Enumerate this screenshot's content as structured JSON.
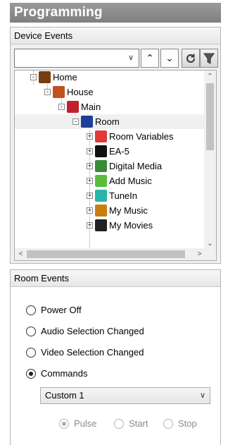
{
  "window": {
    "title": "Programming"
  },
  "device_events": {
    "header": "Device Events",
    "combo_value": "",
    "tree": [
      {
        "label": "Home",
        "icon": "home-icon",
        "expander": "-",
        "color": "#7a3d0c"
      },
      {
        "label": "House",
        "icon": "house-icon",
        "expander": "-",
        "color": "#c0521e"
      },
      {
        "label": "Main",
        "icon": "floor-icon",
        "expander": "-",
        "color": "#c2202e"
      },
      {
        "label": "Room",
        "icon": "room-icon",
        "expander": "-",
        "color": "#1d3f9a",
        "selected": true
      },
      {
        "label": "Room Variables",
        "icon": "variables-icon",
        "expander": "+",
        "color": "#e03a3a"
      },
      {
        "label": "EA-5",
        "icon": "controller-icon",
        "expander": "+",
        "color": "#111111"
      },
      {
        "label": "Digital Media",
        "icon": "digital-media-icon",
        "expander": "+",
        "color": "#3a8a3a"
      },
      {
        "label": "Add Music",
        "icon": "add-music-icon",
        "expander": "+",
        "color": "#5bbd3b"
      },
      {
        "label": "TuneIn",
        "icon": "tunein-icon",
        "expander": "+",
        "color": "#27b5a8"
      },
      {
        "label": "My Music",
        "icon": "my-music-icon",
        "expander": "+",
        "color": "#c97f10"
      },
      {
        "label": "My Movies",
        "icon": "my-movies-icon",
        "expander": "+",
        "color": "#222222"
      }
    ]
  },
  "room_events": {
    "header": "Room Events",
    "options": [
      {
        "label": "Power Off",
        "checked": false
      },
      {
        "label": "Audio Selection Changed",
        "checked": false
      },
      {
        "label": "Video Selection Changed",
        "checked": false
      },
      {
        "label": "Commands",
        "checked": true
      }
    ],
    "command_select": "Custom 1",
    "trigger": [
      {
        "label": "Pulse",
        "checked": true
      },
      {
        "label": "Start",
        "checked": false
      },
      {
        "label": "Stop",
        "checked": false
      }
    ]
  }
}
